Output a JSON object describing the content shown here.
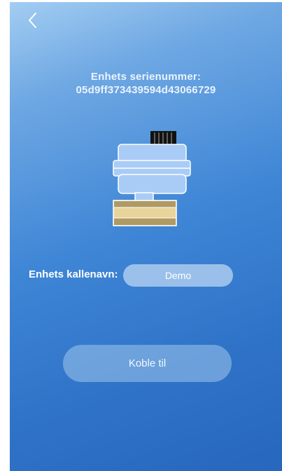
{
  "header": {
    "back_icon": "chevron-left-icon"
  },
  "device": {
    "serial_title": "Enhets serienummer:",
    "serial_number": "05d9ff373439594d43066729",
    "illustration_icon": "valve-actuator-icon"
  },
  "form": {
    "nickname_label": "Enhets kallenavn:",
    "nickname_value": "Demo"
  },
  "actions": {
    "connect_label": "Koble til"
  },
  "colors": {
    "gradient_top": "#a3cdf2",
    "gradient_bottom": "#2767bd",
    "device_body": "#a9ccf6",
    "device_outline": "#ffffff",
    "device_cap": "#111111",
    "device_base_light": "#e8d49a",
    "device_base_dark": "#b09a63"
  }
}
